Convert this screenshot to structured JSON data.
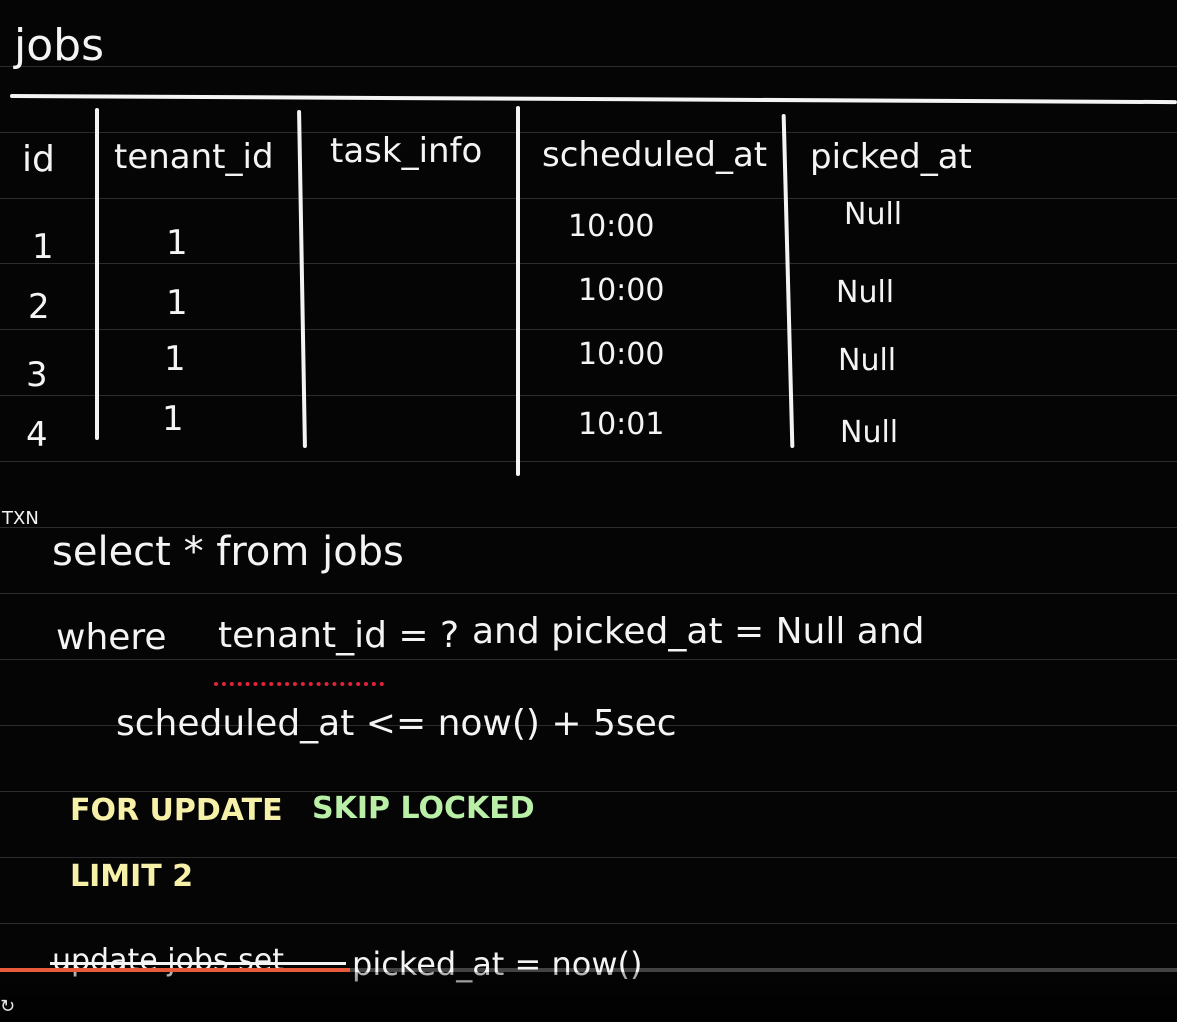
{
  "title": "jobs",
  "table": {
    "headers": [
      "id",
      "tenant_id",
      "task_info",
      "scheduled_at",
      "picked_at"
    ],
    "rows": [
      [
        "1",
        "1",
        "",
        "10:00",
        "Null"
      ],
      [
        "2",
        "1",
        "",
        "10:00",
        "Null"
      ],
      [
        "3",
        "1",
        "",
        "10:00",
        "Null"
      ],
      [
        "4",
        "1",
        "",
        "10:01",
        "Null"
      ]
    ]
  },
  "txn_label": "TXN",
  "query": {
    "line1": "select * from jobs",
    "line2_where": "where",
    "line2_tenant": "tenant_id = ?",
    "line2_rest": "and picked_at = Null and",
    "line3": "scheduled_at <= now() + 5sec",
    "for_update": "FOR UPDATE",
    "skip_locked": "SKIP LOCKED",
    "limit": "LIMIT 2",
    "update_struck": "update jobs set",
    "update_rest": "picked_at = now()"
  },
  "video": {
    "progress_fraction": 0.297
  },
  "colors": {
    "background": "#050505",
    "chalk": "#f4f4f4",
    "for_update": "#f6f0a8",
    "skip_locked": "#b9efa6",
    "underline": "#e0223c",
    "progress": "#e85a3c"
  },
  "icons": {
    "loop": "loop-icon"
  }
}
